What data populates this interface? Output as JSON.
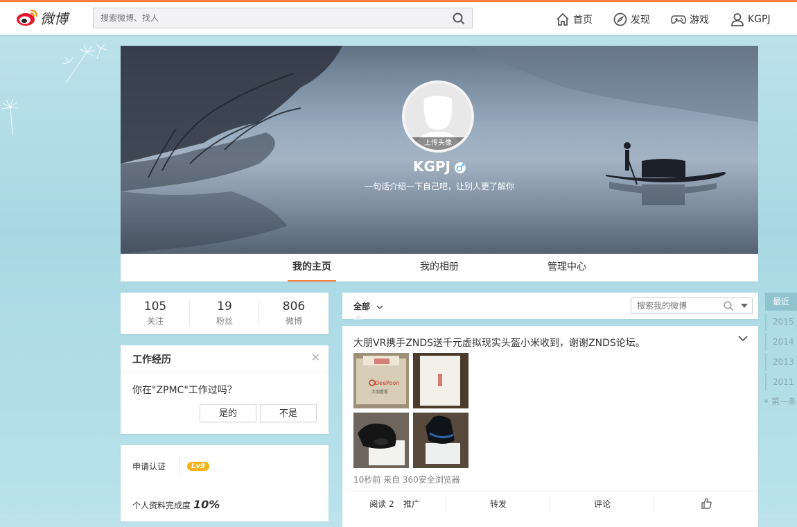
{
  "header": {
    "logo_text": "微博",
    "search_placeholder": "搜索微博、找人",
    "nav": [
      {
        "label": "首页",
        "icon": "home-icon"
      },
      {
        "label": "发现",
        "icon": "compass-icon"
      },
      {
        "label": "游戏",
        "icon": "gamepad-icon"
      },
      {
        "label": "KGPJ",
        "icon": "user-icon"
      }
    ]
  },
  "profile": {
    "avatar_label": "上传头像",
    "username": "KGPJ",
    "gender_symbol": "♂",
    "intro": "一句话介绍一下自己吧，让别人更了解你"
  },
  "tabs": [
    {
      "label": "我的主页",
      "active": true
    },
    {
      "label": "我的相册",
      "active": false
    },
    {
      "label": "管理中心",
      "active": false
    }
  ],
  "stats": [
    {
      "num": "105",
      "label": "关注"
    },
    {
      "num": "19",
      "label": "粉丝"
    },
    {
      "num": "806",
      "label": "微博"
    }
  ],
  "work": {
    "title": "工作经历",
    "question": "你在\"ZPMC\"工作过吗？",
    "yes": "是的",
    "no": "不是"
  },
  "verify": {
    "apply": "申请认证",
    "level": "Lv9",
    "completion_label": "个人资料完成度",
    "completion_value": "10%"
  },
  "feed": {
    "filter_label": "全部",
    "search_placeholder": "搜索我的微博",
    "post": {
      "text": "大朋VR携手ZNDS送千元虚拟现实头盔小米收到，谢谢ZNDS论坛。",
      "meta": "10秒前 来自 360安全浏览器",
      "actions": {
        "read": "阅读 2",
        "promote": "推广",
        "repost": "转发",
        "comment": "评论"
      },
      "box_brand": "DeePoon",
      "box_sub": "大朋看看"
    }
  },
  "timeline": {
    "head": "最近",
    "years": [
      "2015",
      "2014",
      "2013",
      "2011"
    ],
    "first": "第一条"
  },
  "colors": {
    "accent": "#fa7d3c",
    "background": "#b3dde7",
    "level_badge": "#f5b31a"
  }
}
